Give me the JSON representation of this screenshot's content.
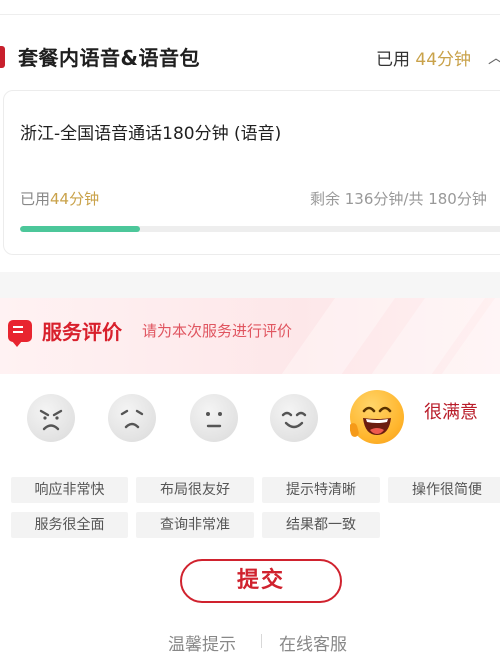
{
  "package": {
    "title": "套餐内语音&语音包",
    "used_prefix": "已用",
    "used_value": "44分钟"
  },
  "card": {
    "title": "浙江-全国语音通话180分钟 (语音)",
    "used_prefix": "已用",
    "used_value": "44分钟",
    "remaining": "剩余 136分钟/共 180分钟",
    "progress_fraction": 0.244
  },
  "evaluation": {
    "title": "服务评价",
    "subtitle": "请为本次服务进行评价",
    "rating_label": "很满意",
    "faces": [
      "angry-face-icon",
      "sad-face-icon",
      "neutral-face-icon",
      "smile-face-icon",
      "very-happy-face-icon"
    ],
    "tags": [
      "响应非常快",
      "布局很友好",
      "提示特清晰",
      "操作很简便",
      "服务很全面",
      "查询非常准",
      "结果都一致"
    ],
    "submit_label": "提交"
  },
  "footer": {
    "tips": "温馨提示",
    "service": "在线客服"
  },
  "colors": {
    "accent_red": "#d0222e",
    "gold": "#c9a24a",
    "progress_green": "#4cc79a"
  }
}
